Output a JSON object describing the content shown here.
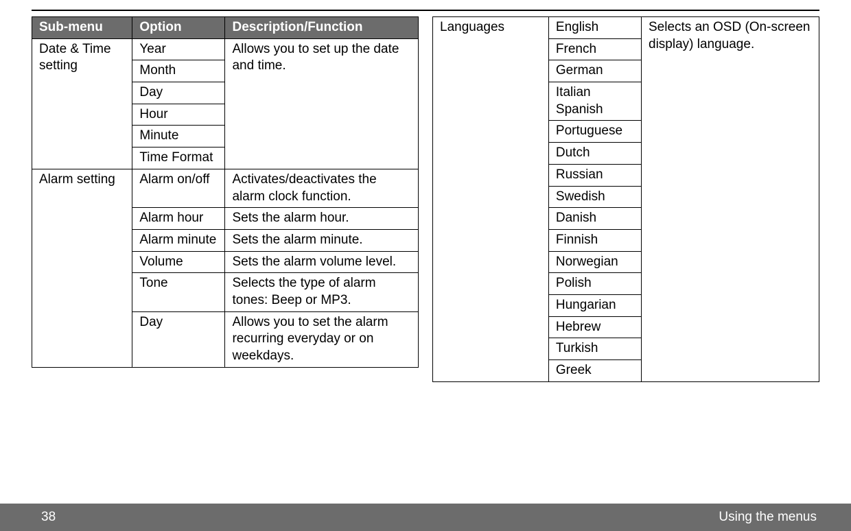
{
  "left": {
    "headers": {
      "c1": "Sub-menu",
      "c2": "Option",
      "c3": "Description/Function"
    },
    "dateTime": {
      "submenu": "Date & Time setting",
      "options": [
        "Year",
        "Month",
        "Day",
        "Hour",
        "Minute",
        "Time Format"
      ],
      "desc": "Allows you to set up the date and time."
    },
    "alarm": {
      "submenu": "Alarm setting",
      "rows": [
        {
          "opt": "Alarm on/off",
          "desc": "Activates/deactivates the alarm clock function."
        },
        {
          "opt": "Alarm hour",
          "desc": "Sets the alarm hour."
        },
        {
          "opt": "Alarm minute",
          "desc": "Sets the alarm minute."
        },
        {
          "opt": "Volume",
          "desc": "Sets the alarm volume level."
        },
        {
          "opt": "Tone",
          "desc": "Selects the type of alarm tones: Beep or MP3."
        },
        {
          "opt": "Day",
          "desc": "Allows you to set the alarm recurring everyday or on weekdays."
        }
      ]
    }
  },
  "right": {
    "submenu": "Languages",
    "options": [
      "English",
      "French",
      "German",
      "Italian Spanish",
      "Portuguese",
      "Dutch",
      "Russian",
      "Swedish",
      "Danish",
      "Finnish",
      "Norwegian",
      "Polish",
      "Hungarian",
      "Hebrew",
      "Turkish",
      "Greek"
    ],
    "desc": "Selects an OSD (On-screen display) language."
  },
  "footer": {
    "page": "38",
    "title": "Using the menus"
  }
}
